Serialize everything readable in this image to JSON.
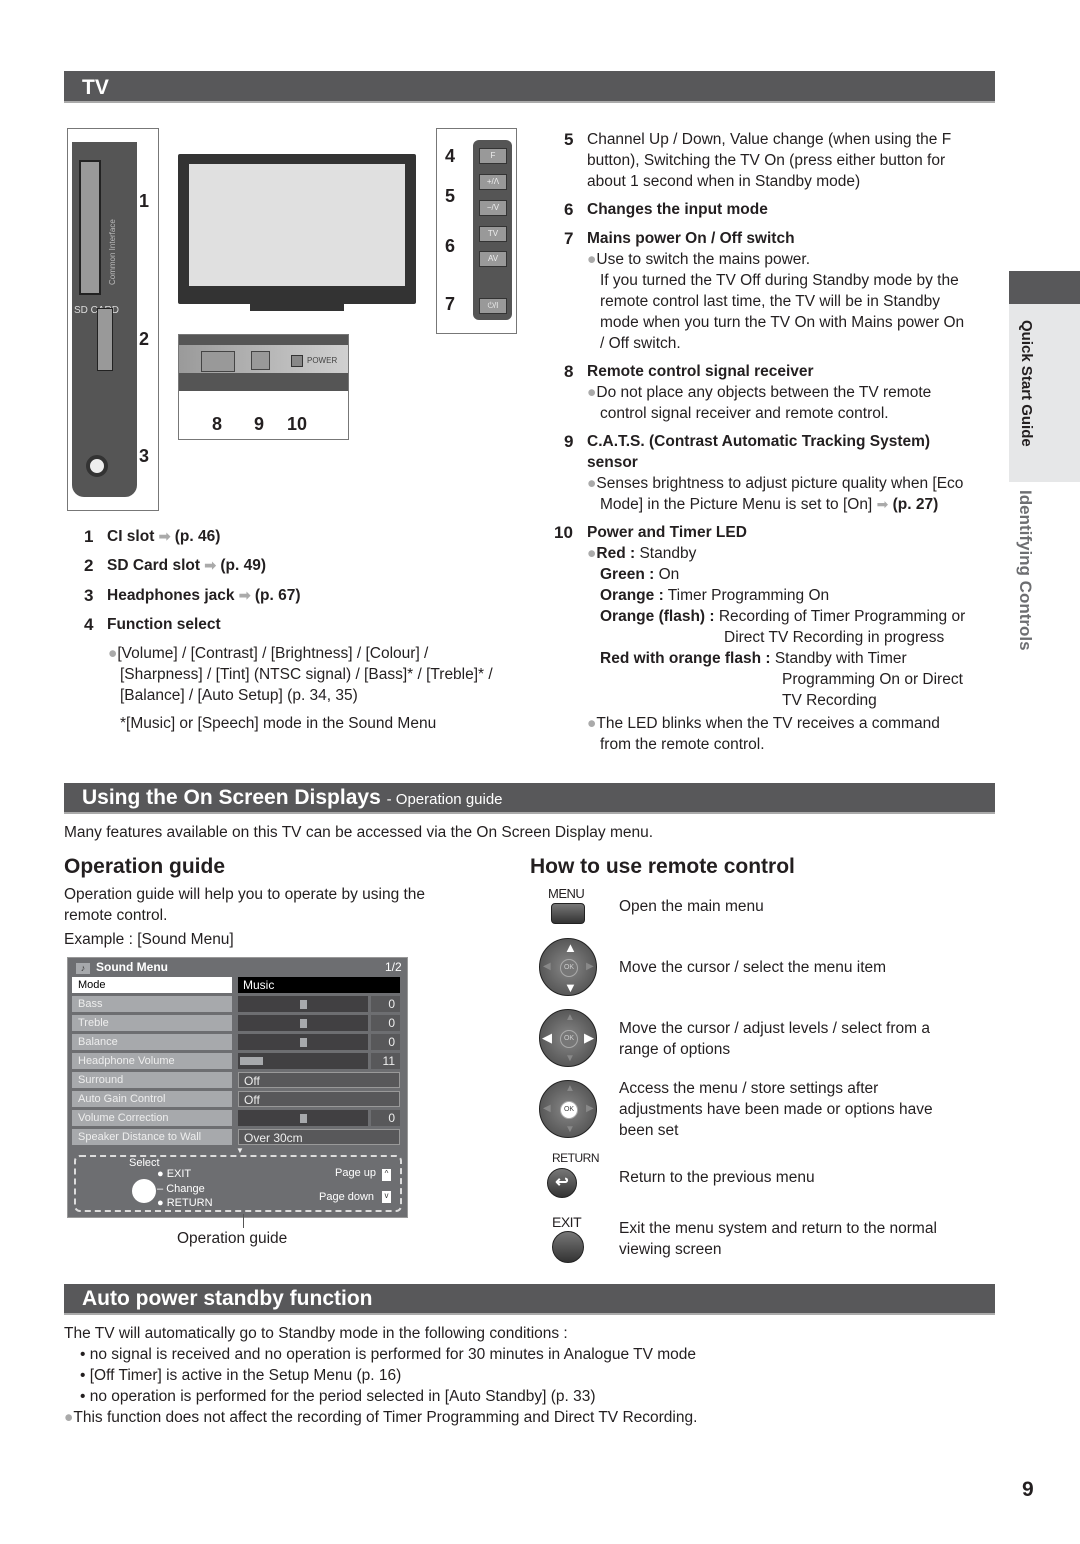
{
  "page_number": "9",
  "side_tabs": {
    "section": "Quick Start Guide",
    "chapter": "Identifying Controls"
  },
  "tv_section": {
    "title": "TV",
    "diagram": {
      "common_interface_label": "Common Interface",
      "sd_card_label": "SD CARD",
      "power_label": "POWER",
      "side_buttons": [
        "F",
        "+/Λ",
        "−/V",
        "TV",
        "AV",
        "⏻/I"
      ],
      "callouts": [
        "1",
        "2",
        "3",
        "4",
        "5",
        "6",
        "7",
        "8",
        "9",
        "10"
      ]
    },
    "left_items": [
      {
        "num": "1",
        "label": "CI slot",
        "ref": "(p. 46)"
      },
      {
        "num": "2",
        "label": "SD Card slot",
        "ref": "(p. 49)"
      },
      {
        "num": "3",
        "label": "Headphones jack",
        "ref": "(p. 67)"
      },
      {
        "num": "4",
        "label": "Function select"
      }
    ],
    "function_select_bullet": [
      "[Volume] / [Contrast] / [Brightness] / [Colour] /",
      "[Sharpness] / [Tint] (NTSC signal) / [Bass]* / [Treble]* /",
      "[Balance] / [Auto Setup] (p. 34, 35)"
    ],
    "function_select_note": "*[Music] or [Speech] mode in the Sound Menu",
    "right_items": {
      "item5": {
        "num": "5",
        "lines": [
          "Channel Up / Down, Value change (when using the F",
          "button), Switching the TV On (press either button for",
          "about 1 second when in Standby mode)"
        ]
      },
      "item6": {
        "num": "6",
        "label": "Changes the input mode"
      },
      "item7": {
        "num": "7",
        "label": "Mains power On / Off switch",
        "bullet": "Use to switch the mains power.",
        "lines": [
          "If you turned the TV Off during Standby mode by the",
          "remote control last time, the TV will be in Standby",
          "mode when you turn the TV On with Mains power On",
          "/ Off switch."
        ]
      },
      "item8": {
        "num": "8",
        "label": "Remote control signal receiver",
        "lines": [
          "Do not place any objects between the TV remote",
          "control signal receiver and remote control."
        ]
      },
      "item9": {
        "num": "9",
        "label_lines": [
          "C.A.T.S. (Contrast Automatic Tracking System)",
          "sensor"
        ],
        "lines": [
          "Senses brightness to adjust picture quality when [Eco",
          "Mode] in the Picture Menu is set to [On]"
        ],
        "ref": "(p. 27)"
      },
      "item10": {
        "num": "10",
        "label": "Power and Timer LED",
        "states": [
          {
            "key": "Red :",
            "value": "Standby"
          },
          {
            "key": "Green :",
            "value": "On"
          },
          {
            "key": "Orange :",
            "value": "Timer Programming On"
          },
          {
            "key": "Orange (flash) :",
            "value": "Recording of Timer Programming or",
            "value2": "Direct TV Recording in progress"
          },
          {
            "key": "Red with orange flash :",
            "value": "Standby with Timer",
            "value2": "Programming On or Direct",
            "value3": "TV Recording"
          }
        ],
        "note": [
          "The LED blinks when the TV receives a command",
          "from the remote control."
        ]
      }
    }
  },
  "osd_section": {
    "title": "Using the On Screen Displays",
    "subtitle": "- Operation guide",
    "intro": "Many features available on this TV can be accessed via the On Screen Display menu.",
    "operation_guide": {
      "heading": "Operation guide",
      "text": [
        "Operation guide will help you to operate by using the",
        "remote control."
      ],
      "example": "Example : [Sound Menu]",
      "caption": "Operation guide",
      "menu": {
        "title": "Sound Menu",
        "page": "1/2",
        "rows": [
          {
            "label": "Mode",
            "value": "Music",
            "type": "select"
          },
          {
            "label": "Bass",
            "value": "0",
            "type": "slider",
            "level": 0.5
          },
          {
            "label": "Treble",
            "value": "0",
            "type": "slider",
            "level": 0.5
          },
          {
            "label": "Balance",
            "value": "0",
            "type": "slider",
            "level": 0.5
          },
          {
            "label": "Headphone Volume",
            "value": "11",
            "type": "bar",
            "level": 0.18
          },
          {
            "label": "Surround",
            "value": "Off",
            "type": "text"
          },
          {
            "label": "Auto Gain Control",
            "value": "Off",
            "type": "text"
          },
          {
            "label": "Volume Correction",
            "value": "0",
            "type": "slider",
            "level": 0.5
          },
          {
            "label": "Speaker Distance to Wall",
            "value": "Over 30cm",
            "type": "text"
          }
        ],
        "guide": {
          "select": "Select",
          "exit": "EXIT",
          "change": "Change",
          "return": "RETURN",
          "page_up": "Page up",
          "page_down": "Page down"
        }
      }
    },
    "remote": {
      "heading": "How to use remote control",
      "items": [
        {
          "button": "MENU",
          "text": [
            "Open the main menu"
          ]
        },
        {
          "button": "cursor-up-down",
          "text": [
            "Move the cursor / select the menu item"
          ]
        },
        {
          "button": "cursor-left-right",
          "text": [
            "Move the cursor / adjust levels / select from a",
            "range of options"
          ]
        },
        {
          "button": "OK",
          "text": [
            "Access the menu / store settings after",
            "adjustments have been made or options have",
            "been set"
          ]
        },
        {
          "button": "RETURN",
          "text": [
            "Return to the previous menu"
          ]
        },
        {
          "button": "EXIT",
          "text": [
            "Exit the menu system and return to the normal",
            "viewing screen"
          ]
        }
      ],
      "ok_label": "OK"
    }
  },
  "auto_standby": {
    "title": "Auto power standby function",
    "intro": "The TV will automatically go to Standby mode in the following conditions :",
    "conditions": [
      "no signal is received and no operation is performed for 30 minutes in Analogue TV mode",
      "[Off Timer] is active in the Setup Menu (p. 16)",
      "no operation is performed for the period selected in [Auto Standby] (p. 33)"
    ],
    "note": "This function does not affect the recording of Timer Programming and Direct TV Recording."
  }
}
